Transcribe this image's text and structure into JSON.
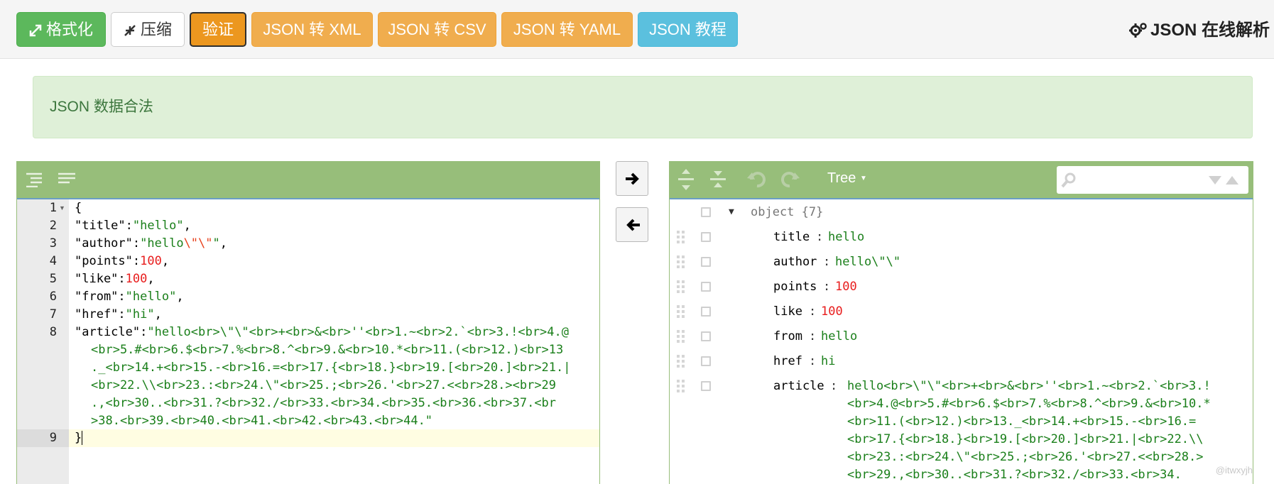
{
  "toolbar": {
    "format_label": "格式化",
    "compress_label": "压缩",
    "validate_label": "验证",
    "to_xml_label": "JSON 转 XML",
    "to_csv_label": "JSON 转 CSV",
    "to_yaml_label": "JSON 转 YAML",
    "tutorial_label": "JSON 教程",
    "brand_label": "JSON 在线解析"
  },
  "alert": {
    "message": "JSON 数据合法"
  },
  "editor": {
    "line_numbers": [
      "1",
      "2",
      "3",
      "4",
      "5",
      "6",
      "7",
      "8",
      "9"
    ],
    "lines": {
      "l1": "{",
      "l2_key": "\"title\"",
      "l2_val": "\"hello\"",
      "l3_key": "\"author\"",
      "l3_val_a": "\"hello",
      "l3_val_b": "\\\"\\\"",
      "l3_val_c": "\"",
      "l4_key": "\"points\"",
      "l4_val": "100",
      "l5_key": "\"like\"",
      "l5_val": "100",
      "l6_key": "\"from\"",
      "l6_val": "\"hello\"",
      "l7_key": "\"href\"",
      "l7_val": "\"hi\"",
      "l8_key": "\"article\"",
      "l8_w1": "\"hello<br>\\\"\\\"<br>+<br>&<br>''<br>1.~<br>2.`<br>3.!<br>4.@",
      "l8_w2": "<br>5.#<br>6.$<br>7.%<br>8.^<br>9.&<br>10.*<br>11.(<br>12.)<br>13",
      "l8_w3": "._<br>14.+<br>15.-<br>16.=<br>17.{<br>18.}<br>19.[<br>20.]<br>21.|",
      "l8_w4": "<br>22.\\\\<br>23.:<br>24.\\\"<br>25.;<br>26.'<br>27.<<br>28.><br>29",
      "l8_w5": ".,<br>30..<br>31.?<br>32./<br>33.<br>34.<br>35.<br>36.<br>37.<br",
      "l8_w6": ">38.<br>39.<br>40.<br>41.<br>42.<br>43.<br>44.\"",
      "l9": "}"
    }
  },
  "tree": {
    "mode_label": "Tree",
    "root_label": "object {7}",
    "rows": [
      {
        "key": "title",
        "value": "hello",
        "kind": "string"
      },
      {
        "key": "author",
        "value": "hello\\\"\\\"",
        "kind": "string"
      },
      {
        "key": "points",
        "value": "100",
        "kind": "number"
      },
      {
        "key": "like",
        "value": "100",
        "kind": "number"
      },
      {
        "key": "from",
        "value": "hello",
        "kind": "string"
      },
      {
        "key": "href",
        "value": "hi",
        "kind": "string"
      },
      {
        "key": "article",
        "kind": "string"
      }
    ],
    "article_lines": [
      "hello<br>\\\"\\\"<br>+<br>&<br>''<br>1.~<br>2.`<br>3.!",
      "<br>4.@<br>5.#<br>6.$<br>7.%<br>8.^<br>9.&<br>10.*",
      "<br>11.(<br>12.)<br>13._<br>14.+<br>15.-<br>16.=",
      "<br>17.{<br>18.}<br>19.[<br>20.]<br>21.|<br>22.\\\\",
      "<br>23.:<br>24.\\\"<br>25.;<br>26.'<br>27.<<br>28.>",
      "<br>29.,<br>30..<br>31.?<br>32./<br>33.<br>34."
    ],
    "separator": ":"
  },
  "watermark": "@itwxyjh",
  "colors": {
    "accent_green": "#97be7a",
    "button_orange": "#f0ad4e",
    "button_green": "#5cb85c",
    "button_blue": "#5bc0de"
  }
}
